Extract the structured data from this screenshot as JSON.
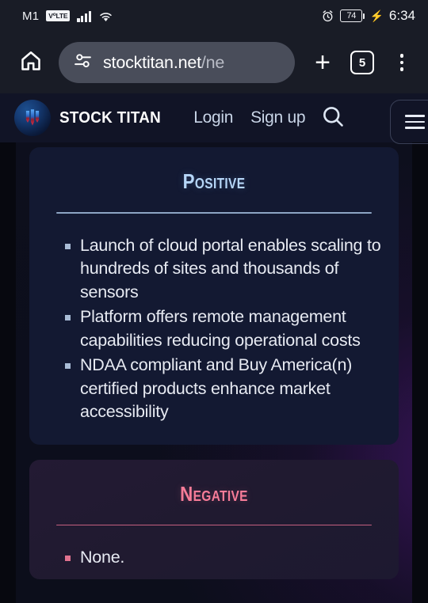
{
  "status_bar": {
    "carrier": "M1",
    "network_badge": "VoLTE",
    "signal_icon": "signal-bars-icon",
    "wifi_icon": "wifi-icon",
    "alarm_icon": "alarm-clock-icon",
    "battery_level": "74",
    "charging_icon": "charging-bolt-icon",
    "time": "6:34"
  },
  "browser": {
    "home_icon": "home-icon",
    "site_settings_icon": "page-settings-icon",
    "url_domain": "stocktitan.net",
    "url_path": "/ne",
    "url_full": "stocktitan.net/ne",
    "new_tab_label": "+",
    "tab_count": "5",
    "menu_icon": "three-dot-menu-icon"
  },
  "site_header": {
    "logo_icon": "stock-titan-logo-icon",
    "brand_name": "STOCK TITAN",
    "login_label": "Login",
    "signup_label": "Sign up",
    "search_icon": "search-icon",
    "hamburger_icon": "hamburger-menu-icon"
  },
  "cards": {
    "positive": {
      "title": "Positive",
      "accent_color": "#b6d6f7",
      "bullets": [
        "Launch of cloud portal enables scaling to hundreds of sites and thousands of sensors",
        "Platform offers remote management capabilities reducing operational costs",
        "NDAA compliant and Buy America(n) certified products enhance market accessibility"
      ]
    },
    "negative": {
      "title": "Negative",
      "accent_color": "#f77c98",
      "bullets": [
        "None."
      ]
    }
  }
}
